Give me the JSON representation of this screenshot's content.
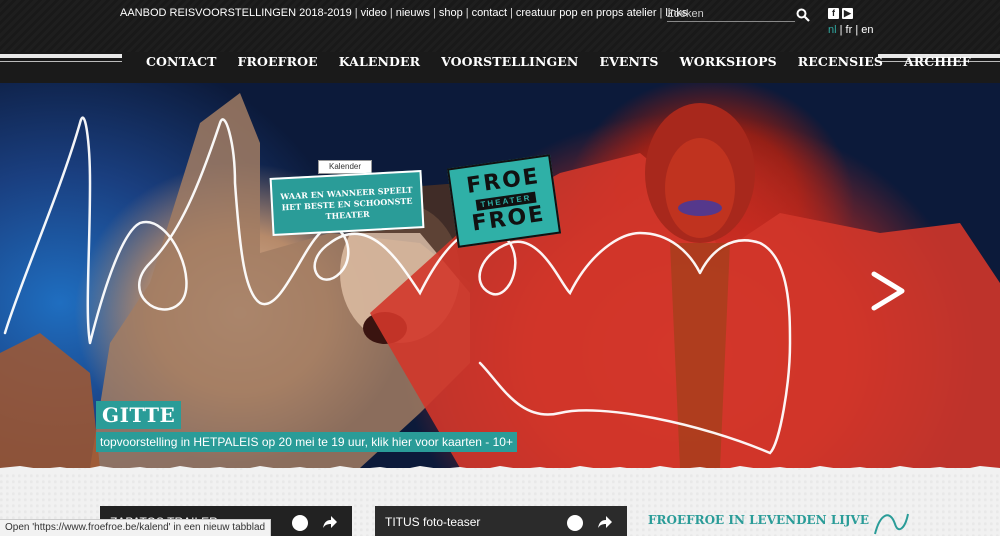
{
  "topbar": {
    "links": [
      "AANBOD REISVOORSTELLINGEN 2018-2019",
      "video",
      "nieuws",
      "shop",
      "contact",
      "creatuur pop en props atelier",
      "links"
    ],
    "search_placeholder": "Zoeken",
    "social": [
      "facebook-icon",
      "youtube-icon"
    ],
    "languages": [
      "nl",
      "fr",
      "en"
    ],
    "active_language": "nl"
  },
  "nav": {
    "items": [
      "CONTACT",
      "FROEFROE",
      "KALENDER",
      "VOORSTELLINGEN",
      "EVENTS",
      "WORKSHOPS",
      "RECENSIES",
      "ARCHIEF"
    ]
  },
  "hero": {
    "kalender_tab": "Kalender",
    "kalender_text": "WAAR EN WANNEER SPEELT HET BESTE EN SCHOONSTE THEATER",
    "logo": {
      "line1": "FROE",
      "line2": "THEATER",
      "line3": "FROE"
    },
    "title": "GITTE",
    "subtitle": "topvoorstelling in HETPALEIS op 20 mei te 19 uur, klik hier voor kaarten - 10+",
    "accent_color": "#2a9c98"
  },
  "bottom": {
    "video1_title": "ZAPATOS TRAILER",
    "video2_title": "TITUS foto-teaser",
    "right_heading": "FROEFROE IN LEVENDEN LIJVE"
  },
  "status_bar": "Open 'https://www.froefroe.be/kalend' in een nieuw tabblad"
}
